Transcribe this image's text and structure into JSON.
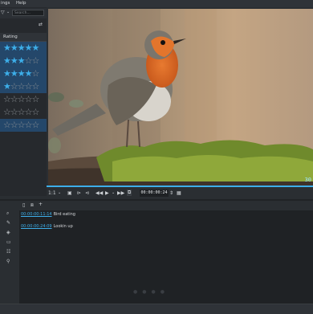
{
  "menubar": {
    "items": [
      "ings",
      "Help"
    ]
  },
  "toolbar": {
    "search_placeholder": "Search..."
  },
  "rating_header": "Rating",
  "ratings": [
    {
      "filled": 5,
      "selected": true
    },
    {
      "filled": 3,
      "selected": true
    },
    {
      "filled": 4,
      "selected": true
    },
    {
      "filled": 1,
      "selected": true
    },
    {
      "filled": 0,
      "selected": false
    },
    {
      "filled": 0,
      "selected": false
    },
    {
      "filled": 0,
      "selected": true
    }
  ],
  "monitor": {
    "timestamp": "30"
  },
  "controls": {
    "timecode": "00:00:00:24",
    "zoom": "1:1"
  },
  "notes": [
    {
      "timecode": "00:00:00:11:14",
      "text": "Bird eating"
    },
    {
      "timecode": "00:00:00:24:09",
      "text": "Lookin up"
    }
  ],
  "colors": {
    "accent": "#3daee9",
    "selection": "#24476a",
    "background": "#2a2e32"
  }
}
